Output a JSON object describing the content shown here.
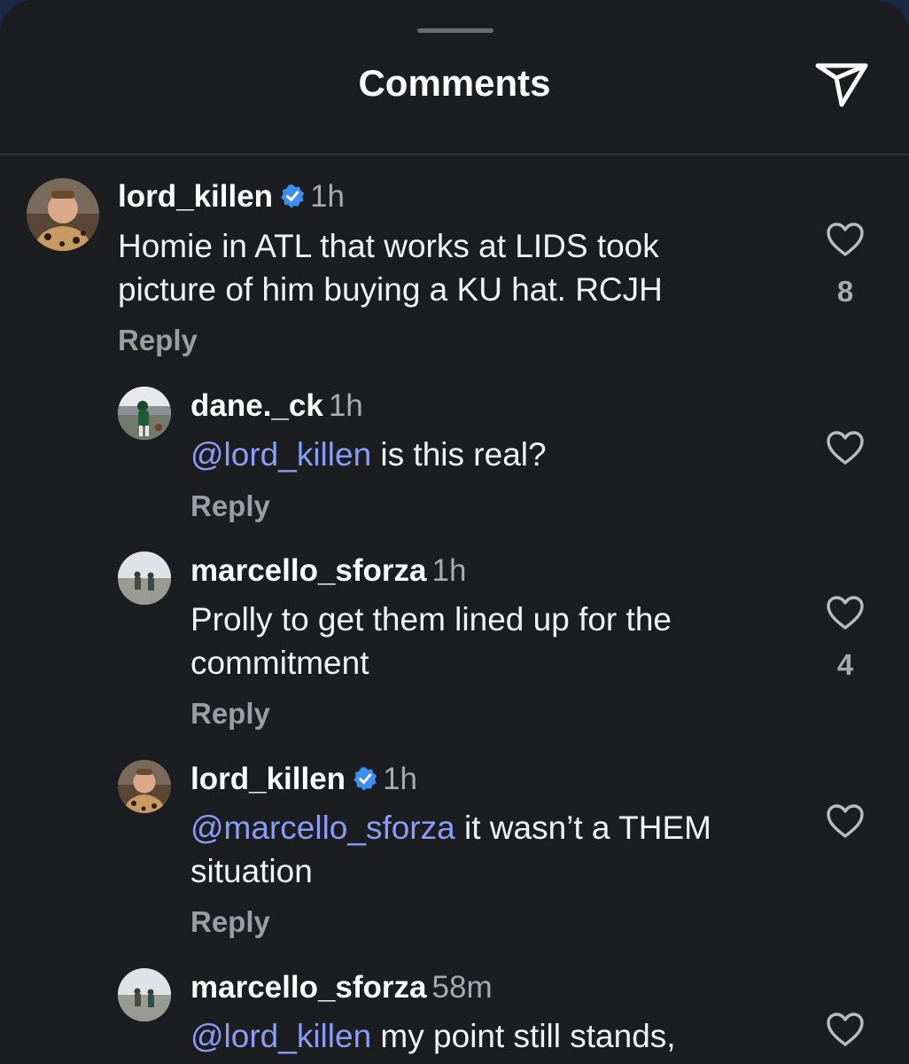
{
  "header": {
    "title": "Comments",
    "share_icon": "send-icon"
  },
  "colors": {
    "background": "#1b1d21",
    "mention": "#8b9cf5",
    "verified": "#3b8ff5",
    "secondary_text": "#a7aab0"
  },
  "comments": [
    {
      "username": "lord_killen",
      "verified": true,
      "time": "1h",
      "text": "Homie in ATL that works at LIDS took picture of him buying a KU hat. RCJH",
      "reply_label": "Reply",
      "likes": "8"
    },
    {
      "username": "dane._ck",
      "verified": false,
      "time": "1h",
      "mention": "@lord_killen",
      "text": " is this real?",
      "reply_label": "Reply",
      "likes": ""
    },
    {
      "username": "marcello_sforza",
      "verified": false,
      "time": "1h",
      "text": "Prolly to get them lined up for the commitment",
      "reply_label": "Reply",
      "likes": "4"
    },
    {
      "username": "lord_killen",
      "verified": true,
      "time": "1h",
      "mention": "@marcello_sforza",
      "text": " it wasn’t a THEM situation",
      "reply_label": "Reply",
      "likes": ""
    },
    {
      "username": "marcello_sforza",
      "verified": false,
      "time": "58m",
      "mention": "@lord_killen",
      "text": " my point still stands,",
      "likes": ""
    }
  ]
}
